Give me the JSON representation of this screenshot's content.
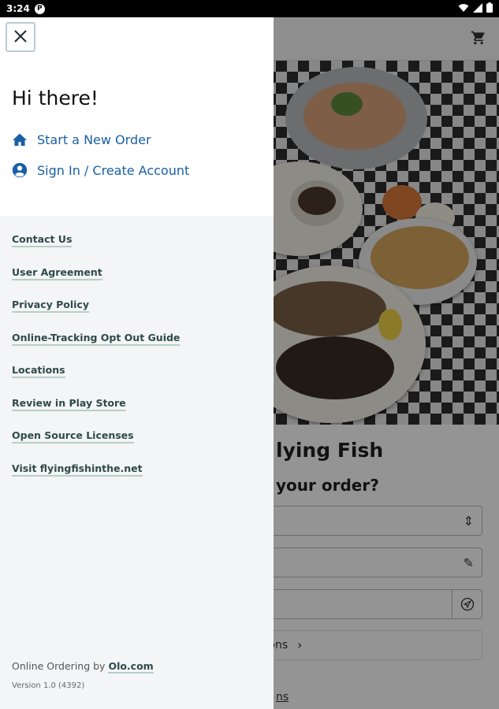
{
  "status_bar": {
    "time": "3:24",
    "app_icon": "P"
  },
  "background": {
    "restaurant_title_partial": "lying Fish",
    "question_partial": "your order?",
    "options_partial": "tions",
    "link_partial": "ns",
    "cart_icon": "cart-icon",
    "hero_colors": {
      "checker": "#2d2d2d",
      "plate": "#f2efe6"
    }
  },
  "drawer": {
    "close_icon": "close-icon",
    "greeting": "Hi there!",
    "primary_links": [
      {
        "label": "Start a New Order",
        "icon": "home-icon"
      },
      {
        "label": "Sign In / Create Account",
        "icon": "account-circle-icon"
      }
    ],
    "secondary_links": [
      "Contact Us",
      "User Agreement",
      "Privacy Policy",
      "Online-Tracking Opt Out Guide",
      "Locations",
      "Review in Play Store",
      "Open Source Licenses",
      "Visit flyingfishinthe.net"
    ],
    "footer": {
      "prefix": "Online Ordering by ",
      "olo_link": "Olo.com",
      "version": "Version 1.0 (4392)"
    }
  },
  "colors": {
    "accent": "#1a5fa6",
    "link_underline": "#b6cfc7",
    "link_text": "#2e4a4a"
  }
}
